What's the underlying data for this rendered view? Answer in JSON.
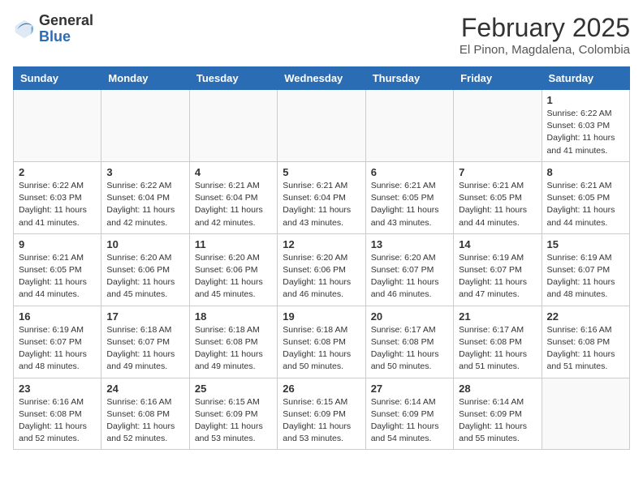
{
  "header": {
    "logo_general": "General",
    "logo_blue": "Blue",
    "month_year": "February 2025",
    "location": "El Pinon, Magdalena, Colombia"
  },
  "weekdays": [
    "Sunday",
    "Monday",
    "Tuesday",
    "Wednesday",
    "Thursday",
    "Friday",
    "Saturday"
  ],
  "weeks": [
    [
      {
        "day": "",
        "info": ""
      },
      {
        "day": "",
        "info": ""
      },
      {
        "day": "",
        "info": ""
      },
      {
        "day": "",
        "info": ""
      },
      {
        "day": "",
        "info": ""
      },
      {
        "day": "",
        "info": ""
      },
      {
        "day": "1",
        "info": "Sunrise: 6:22 AM\nSunset: 6:03 PM\nDaylight: 11 hours and 41 minutes."
      }
    ],
    [
      {
        "day": "2",
        "info": "Sunrise: 6:22 AM\nSunset: 6:03 PM\nDaylight: 11 hours and 41 minutes."
      },
      {
        "day": "3",
        "info": "Sunrise: 6:22 AM\nSunset: 6:04 PM\nDaylight: 11 hours and 42 minutes."
      },
      {
        "day": "4",
        "info": "Sunrise: 6:21 AM\nSunset: 6:04 PM\nDaylight: 11 hours and 42 minutes."
      },
      {
        "day": "5",
        "info": "Sunrise: 6:21 AM\nSunset: 6:04 PM\nDaylight: 11 hours and 43 minutes."
      },
      {
        "day": "6",
        "info": "Sunrise: 6:21 AM\nSunset: 6:05 PM\nDaylight: 11 hours and 43 minutes."
      },
      {
        "day": "7",
        "info": "Sunrise: 6:21 AM\nSunset: 6:05 PM\nDaylight: 11 hours and 44 minutes."
      },
      {
        "day": "8",
        "info": "Sunrise: 6:21 AM\nSunset: 6:05 PM\nDaylight: 11 hours and 44 minutes."
      }
    ],
    [
      {
        "day": "9",
        "info": "Sunrise: 6:21 AM\nSunset: 6:05 PM\nDaylight: 11 hours and 44 minutes."
      },
      {
        "day": "10",
        "info": "Sunrise: 6:20 AM\nSunset: 6:06 PM\nDaylight: 11 hours and 45 minutes."
      },
      {
        "day": "11",
        "info": "Sunrise: 6:20 AM\nSunset: 6:06 PM\nDaylight: 11 hours and 45 minutes."
      },
      {
        "day": "12",
        "info": "Sunrise: 6:20 AM\nSunset: 6:06 PM\nDaylight: 11 hours and 46 minutes."
      },
      {
        "day": "13",
        "info": "Sunrise: 6:20 AM\nSunset: 6:07 PM\nDaylight: 11 hours and 46 minutes."
      },
      {
        "day": "14",
        "info": "Sunrise: 6:19 AM\nSunset: 6:07 PM\nDaylight: 11 hours and 47 minutes."
      },
      {
        "day": "15",
        "info": "Sunrise: 6:19 AM\nSunset: 6:07 PM\nDaylight: 11 hours and 48 minutes."
      }
    ],
    [
      {
        "day": "16",
        "info": "Sunrise: 6:19 AM\nSunset: 6:07 PM\nDaylight: 11 hours and 48 minutes."
      },
      {
        "day": "17",
        "info": "Sunrise: 6:18 AM\nSunset: 6:07 PM\nDaylight: 11 hours and 49 minutes."
      },
      {
        "day": "18",
        "info": "Sunrise: 6:18 AM\nSunset: 6:08 PM\nDaylight: 11 hours and 49 minutes."
      },
      {
        "day": "19",
        "info": "Sunrise: 6:18 AM\nSunset: 6:08 PM\nDaylight: 11 hours and 50 minutes."
      },
      {
        "day": "20",
        "info": "Sunrise: 6:17 AM\nSunset: 6:08 PM\nDaylight: 11 hours and 50 minutes."
      },
      {
        "day": "21",
        "info": "Sunrise: 6:17 AM\nSunset: 6:08 PM\nDaylight: 11 hours and 51 minutes."
      },
      {
        "day": "22",
        "info": "Sunrise: 6:16 AM\nSunset: 6:08 PM\nDaylight: 11 hours and 51 minutes."
      }
    ],
    [
      {
        "day": "23",
        "info": "Sunrise: 6:16 AM\nSunset: 6:08 PM\nDaylight: 11 hours and 52 minutes."
      },
      {
        "day": "24",
        "info": "Sunrise: 6:16 AM\nSunset: 6:08 PM\nDaylight: 11 hours and 52 minutes."
      },
      {
        "day": "25",
        "info": "Sunrise: 6:15 AM\nSunset: 6:09 PM\nDaylight: 11 hours and 53 minutes."
      },
      {
        "day": "26",
        "info": "Sunrise: 6:15 AM\nSunset: 6:09 PM\nDaylight: 11 hours and 53 minutes."
      },
      {
        "day": "27",
        "info": "Sunrise: 6:14 AM\nSunset: 6:09 PM\nDaylight: 11 hours and 54 minutes."
      },
      {
        "day": "28",
        "info": "Sunrise: 6:14 AM\nSunset: 6:09 PM\nDaylight: 11 hours and 55 minutes."
      },
      {
        "day": "",
        "info": ""
      }
    ]
  ]
}
